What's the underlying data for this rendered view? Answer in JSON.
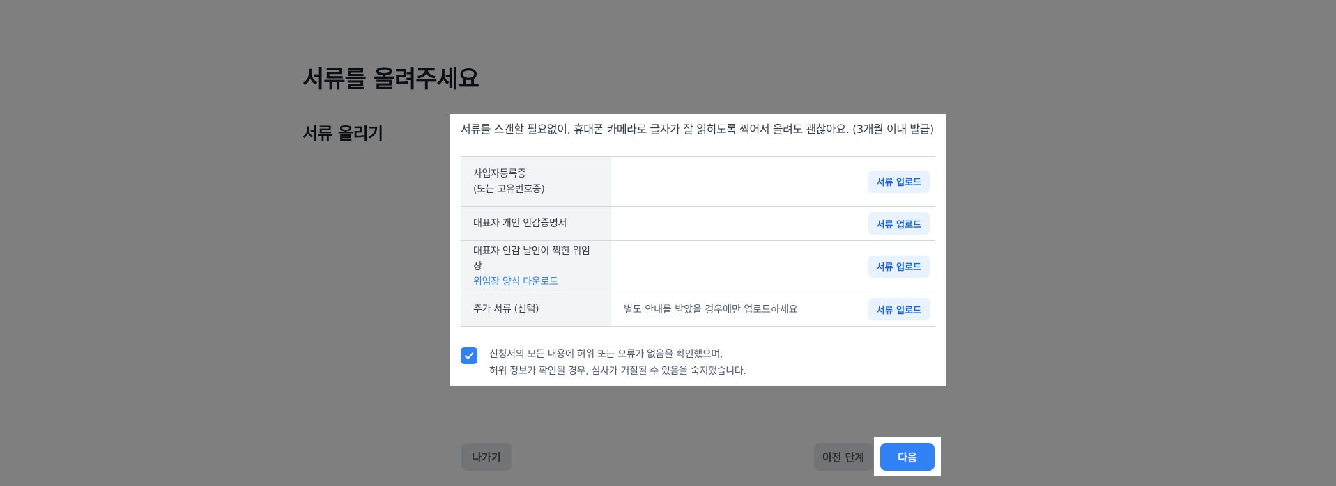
{
  "page": {
    "title": "서류를 올려주세요",
    "section_title": "서류 올리기"
  },
  "notice": "서류를 스캔할 필요없이, 휴대폰 카메라로 글자가 잘 읽히도록 찍어서 올려도 괜찮아요. (3개월 이내 발급)",
  "documents": [
    {
      "label": "사업자등록증",
      "sublabel": "(또는 고유번호증)",
      "note": "",
      "button": "서류 업로드"
    },
    {
      "label": "대표자 개인 인감증명서",
      "note": "",
      "button": "서류 업로드"
    },
    {
      "label": "대표자 인감 날인이 찍힌 위임장",
      "link": "위임장 양식 다운로드",
      "note": "",
      "button": "서류 업로드"
    },
    {
      "label": "추가 서류 (선택)",
      "note": "별도 안내를 받았을 경우에만 업로드하세요",
      "button": "서류 업로드"
    }
  ],
  "agreement": {
    "checked": true,
    "line1": "신청서의 모든 내용에 허위 또는 오류가 없음을 확인했으며,",
    "line2": "허위 정보가 확인될 경우, 심사가 거절될 수 있음을 숙지했습니다."
  },
  "buttons": {
    "exit": "나가기",
    "prev": "이전 단계",
    "next": "다음"
  },
  "colors": {
    "primary": "#3182f6",
    "upload_bg": "#e8f3ff",
    "upload_text": "#1b64da",
    "overlay": "rgba(0,0,0,0.5)"
  },
  "icons": {
    "checkbox": "check-icon"
  }
}
